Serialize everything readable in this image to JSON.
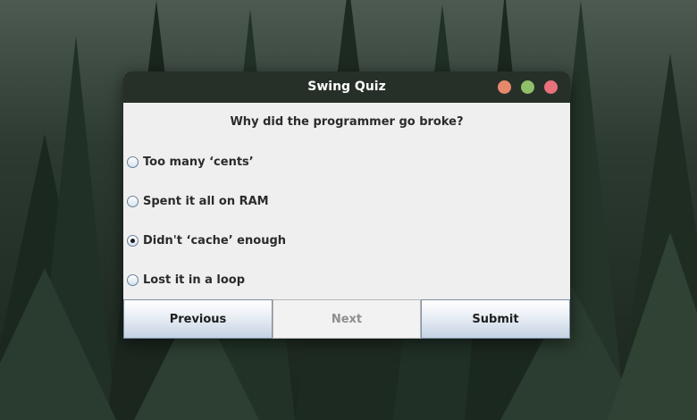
{
  "window": {
    "title": "Swing Quiz",
    "controls": [
      "minimize-icon",
      "maximize-icon",
      "close-icon"
    ]
  },
  "quiz": {
    "question": "Why did the programmer go broke?",
    "options": [
      {
        "label": "Too many ‘cents’",
        "selected": false
      },
      {
        "label": "Spent it all on RAM",
        "selected": false
      },
      {
        "label": "Didn't ‘cache’ enough",
        "selected": true
      },
      {
        "label": "Lost it in a loop",
        "selected": false
      }
    ]
  },
  "buttons": {
    "previous": "Previous",
    "next": "Next",
    "next_enabled": false,
    "submit": "Submit"
  },
  "colors": {
    "titlebar": "#263028",
    "window_bg": "#efefef",
    "minimize": "#e6896b",
    "maximize": "#8fbf6a",
    "close": "#e8717b"
  }
}
